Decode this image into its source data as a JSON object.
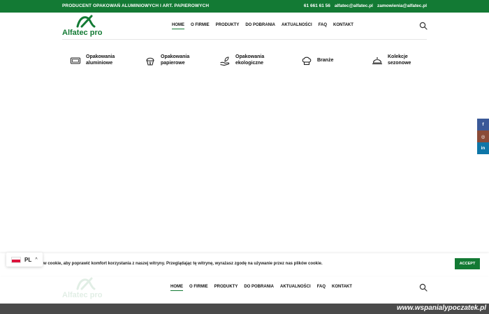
{
  "topbar": {
    "tagline": "PRODUCENT OPAKOWAŃ ALUMINIOWYCH I ART. PAPIEROWYCH",
    "phone": "61 661 61 56",
    "email1": "alfatec@alfatec.pl",
    "email2": "zamowienia@alfatec.pl"
  },
  "logo": {
    "text": "Alfatec pro",
    "brand_color": "#137a34"
  },
  "nav": {
    "items": [
      {
        "label": "HOME",
        "active": true
      },
      {
        "label": "O FIRMIE"
      },
      {
        "label": "PRODUKTY"
      },
      {
        "label": "DO POBRANIA"
      },
      {
        "label": "AKTUALNOŚCI"
      },
      {
        "label": "FAQ"
      },
      {
        "label": "KONTAKT"
      }
    ],
    "search_icon": "search-icon"
  },
  "categories": [
    {
      "line1": "Opakowania",
      "line2": "aluminiowe",
      "icon": "tray-icon"
    },
    {
      "line1": "Opakowania",
      "line2": "papierowe",
      "icon": "cupcake-icon"
    },
    {
      "line1": "Opakowania",
      "line2": "ekologiczne",
      "icon": "eco-hand-icon"
    },
    {
      "line1": "Branże",
      "line2": "",
      "icon": "chef-hat-icon"
    },
    {
      "line1": "Kolekcje",
      "line2": "sezonowe",
      "icon": "cloche-icon"
    }
  ],
  "social": [
    {
      "label": "f",
      "color": "#3b5998",
      "icon": "facebook-icon"
    },
    {
      "label": "◎",
      "color": "#8a4b38",
      "icon": "instagram-icon"
    },
    {
      "label": "in",
      "color": "#0e76a8",
      "icon": "linkedin-icon"
    }
  ],
  "cookie": {
    "text": "w cookie, aby poprawić komfort korzystania z naszej witryny. Przeglądając tę witrynę, wyrażasz zgodę na używanie przez nas plików cookie.",
    "accept_label": "ACCEPT"
  },
  "language": {
    "code": "PL"
  },
  "watermark": "www.wspanialypoczatek.pl"
}
